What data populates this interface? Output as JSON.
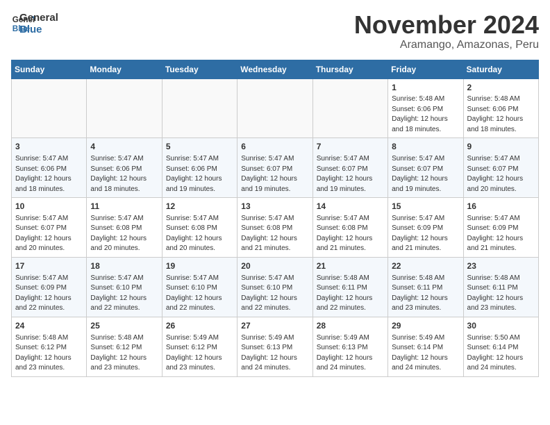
{
  "header": {
    "logo_line1": "General",
    "logo_line2": "Blue",
    "title": "November 2024",
    "subtitle": "Aramango, Amazonas, Peru"
  },
  "calendar": {
    "days_of_week": [
      "Sunday",
      "Monday",
      "Tuesday",
      "Wednesday",
      "Thursday",
      "Friday",
      "Saturday"
    ],
    "weeks": [
      [
        {
          "day": "",
          "info": ""
        },
        {
          "day": "",
          "info": ""
        },
        {
          "day": "",
          "info": ""
        },
        {
          "day": "",
          "info": ""
        },
        {
          "day": "",
          "info": ""
        },
        {
          "day": "1",
          "info": "Sunrise: 5:48 AM\nSunset: 6:06 PM\nDaylight: 12 hours\nand 18 minutes."
        },
        {
          "day": "2",
          "info": "Sunrise: 5:48 AM\nSunset: 6:06 PM\nDaylight: 12 hours\nand 18 minutes."
        }
      ],
      [
        {
          "day": "3",
          "info": "Sunrise: 5:47 AM\nSunset: 6:06 PM\nDaylight: 12 hours\nand 18 minutes."
        },
        {
          "day": "4",
          "info": "Sunrise: 5:47 AM\nSunset: 6:06 PM\nDaylight: 12 hours\nand 18 minutes."
        },
        {
          "day": "5",
          "info": "Sunrise: 5:47 AM\nSunset: 6:06 PM\nDaylight: 12 hours\nand 19 minutes."
        },
        {
          "day": "6",
          "info": "Sunrise: 5:47 AM\nSunset: 6:07 PM\nDaylight: 12 hours\nand 19 minutes."
        },
        {
          "day": "7",
          "info": "Sunrise: 5:47 AM\nSunset: 6:07 PM\nDaylight: 12 hours\nand 19 minutes."
        },
        {
          "day": "8",
          "info": "Sunrise: 5:47 AM\nSunset: 6:07 PM\nDaylight: 12 hours\nand 19 minutes."
        },
        {
          "day": "9",
          "info": "Sunrise: 5:47 AM\nSunset: 6:07 PM\nDaylight: 12 hours\nand 20 minutes."
        }
      ],
      [
        {
          "day": "10",
          "info": "Sunrise: 5:47 AM\nSunset: 6:07 PM\nDaylight: 12 hours\nand 20 minutes."
        },
        {
          "day": "11",
          "info": "Sunrise: 5:47 AM\nSunset: 6:08 PM\nDaylight: 12 hours\nand 20 minutes."
        },
        {
          "day": "12",
          "info": "Sunrise: 5:47 AM\nSunset: 6:08 PM\nDaylight: 12 hours\nand 20 minutes."
        },
        {
          "day": "13",
          "info": "Sunrise: 5:47 AM\nSunset: 6:08 PM\nDaylight: 12 hours\nand 21 minutes."
        },
        {
          "day": "14",
          "info": "Sunrise: 5:47 AM\nSunset: 6:08 PM\nDaylight: 12 hours\nand 21 minutes."
        },
        {
          "day": "15",
          "info": "Sunrise: 5:47 AM\nSunset: 6:09 PM\nDaylight: 12 hours\nand 21 minutes."
        },
        {
          "day": "16",
          "info": "Sunrise: 5:47 AM\nSunset: 6:09 PM\nDaylight: 12 hours\nand 21 minutes."
        }
      ],
      [
        {
          "day": "17",
          "info": "Sunrise: 5:47 AM\nSunset: 6:09 PM\nDaylight: 12 hours\nand 22 minutes."
        },
        {
          "day": "18",
          "info": "Sunrise: 5:47 AM\nSunset: 6:10 PM\nDaylight: 12 hours\nand 22 minutes."
        },
        {
          "day": "19",
          "info": "Sunrise: 5:47 AM\nSunset: 6:10 PM\nDaylight: 12 hours\nand 22 minutes."
        },
        {
          "day": "20",
          "info": "Sunrise: 5:47 AM\nSunset: 6:10 PM\nDaylight: 12 hours\nand 22 minutes."
        },
        {
          "day": "21",
          "info": "Sunrise: 5:48 AM\nSunset: 6:11 PM\nDaylight: 12 hours\nand 22 minutes."
        },
        {
          "day": "22",
          "info": "Sunrise: 5:48 AM\nSunset: 6:11 PM\nDaylight: 12 hours\nand 23 minutes."
        },
        {
          "day": "23",
          "info": "Sunrise: 5:48 AM\nSunset: 6:11 PM\nDaylight: 12 hours\nand 23 minutes."
        }
      ],
      [
        {
          "day": "24",
          "info": "Sunrise: 5:48 AM\nSunset: 6:12 PM\nDaylight: 12 hours\nand 23 minutes."
        },
        {
          "day": "25",
          "info": "Sunrise: 5:48 AM\nSunset: 6:12 PM\nDaylight: 12 hours\nand 23 minutes."
        },
        {
          "day": "26",
          "info": "Sunrise: 5:49 AM\nSunset: 6:12 PM\nDaylight: 12 hours\nand 23 minutes."
        },
        {
          "day": "27",
          "info": "Sunrise: 5:49 AM\nSunset: 6:13 PM\nDaylight: 12 hours\nand 24 minutes."
        },
        {
          "day": "28",
          "info": "Sunrise: 5:49 AM\nSunset: 6:13 PM\nDaylight: 12 hours\nand 24 minutes."
        },
        {
          "day": "29",
          "info": "Sunrise: 5:49 AM\nSunset: 6:14 PM\nDaylight: 12 hours\nand 24 minutes."
        },
        {
          "day": "30",
          "info": "Sunrise: 5:50 AM\nSunset: 6:14 PM\nDaylight: 12 hours\nand 24 minutes."
        }
      ]
    ]
  }
}
